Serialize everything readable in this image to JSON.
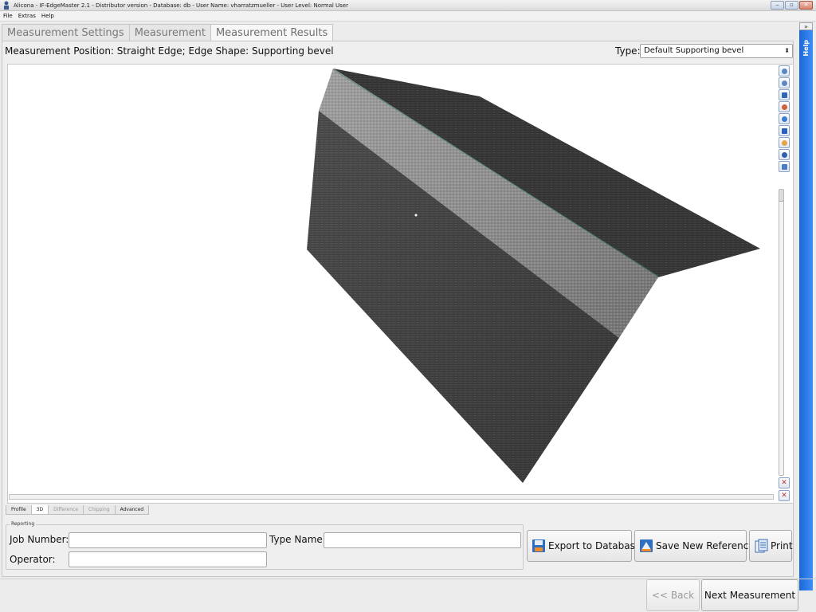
{
  "window": {
    "title": "Alicona - IF-EdgeMaster 2.1 - Distributor version - Database: db - User Name: vharratzmueller - User Level: Normal User",
    "controls": [
      "minimize",
      "maximize",
      "close"
    ]
  },
  "menu": {
    "items": [
      "File",
      "Extras",
      "Help"
    ]
  },
  "help_strip": {
    "toggle": "»",
    "label": "Help"
  },
  "tabs": {
    "items": [
      "Measurement Settings",
      "Measurement",
      "Measurement Results"
    ],
    "active": "Measurement Results"
  },
  "measurement": {
    "position_text": "Measurement Position: Straight Edge; Edge Shape: Supporting bevel",
    "type_label": "Type:",
    "type_value": "Default Supporting bevel"
  },
  "viewer": {
    "toolbar_icons": [
      "zoom-in-icon",
      "zoom-out-icon",
      "home-view-icon",
      "rotate-icon",
      "reset-rotation-icon",
      "color-map-icon",
      "light-icon",
      "settings-icon",
      "fit-view-icon"
    ],
    "bottom_icons": [
      "axes-icon",
      "axes-reset-icon"
    ],
    "surface_colors": {
      "top_face": "#3a3a3a",
      "bevel_face": "#8c8c8c",
      "front_face": "#474747"
    }
  },
  "sub_tabs": {
    "items": [
      "Profile",
      "3D",
      "Difference",
      "Chipping",
      "Advanced"
    ],
    "active": "3D",
    "disabled": [
      "Difference",
      "Chipping"
    ]
  },
  "reporting": {
    "legend": "Reporting",
    "job_number_label": "Job Number:",
    "job_number_value": "",
    "type_name_label": "Type Name:",
    "type_name_value": "",
    "operator_label": "Operator:",
    "operator_value": ""
  },
  "actions": {
    "export_label": "Export to Database",
    "save_reference_label": "Save New Reference",
    "print_label": "Print"
  },
  "navigation": {
    "back_label": "<< Back",
    "next_label": "Next Measurement"
  }
}
